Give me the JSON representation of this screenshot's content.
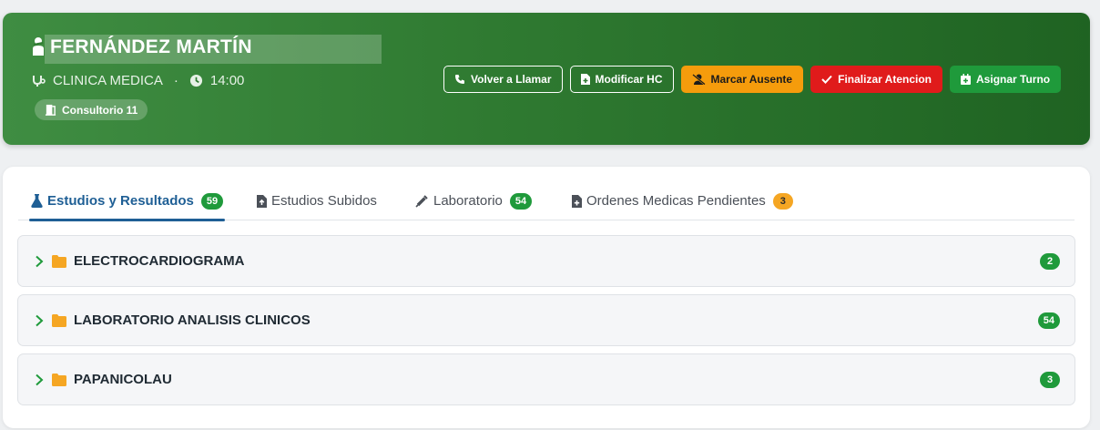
{
  "patient": {
    "name": "FERNÁNDEZ MARTÍN",
    "specialty": "CLINICA MEDICA",
    "separator": "·",
    "time": "14:00",
    "room": "Consultorio 11"
  },
  "actions": {
    "recall": "Volver a Llamar",
    "edit_hc": "Modificar HC",
    "mark_absent": "Marcar Ausente",
    "finish": "Finalizar Atencion",
    "assign": "Asignar Turno"
  },
  "tabs": [
    {
      "label": "Estudios y Resultados",
      "badge": "59",
      "active": true
    },
    {
      "label": "Estudios Subidos",
      "badge": ""
    },
    {
      "label": "Laboratorio",
      "badge": "54"
    },
    {
      "label": "Ordenes Medicas Pendientes",
      "badge": "3"
    }
  ],
  "folders": [
    {
      "label": "ELECTROCARDIOGRAMA",
      "count": "2"
    },
    {
      "label": "LABORATORIO ANALISIS CLINICOS",
      "count": "54"
    },
    {
      "label": "PAPANICOLAU",
      "count": "3"
    }
  ],
  "colors": {
    "header_green": "#2f7a31",
    "primary_blue": "#1f5f95",
    "success": "#1f9a3b",
    "warning": "#f59c0c",
    "danger": "#e01b1b",
    "folder": "#f5a623"
  }
}
